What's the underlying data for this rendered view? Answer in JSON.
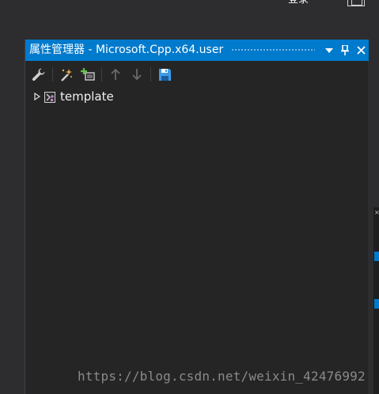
{
  "top": {
    "login_label": "登录"
  },
  "panel": {
    "title": "属性管理器 - Microsoft.Cpp.x64.user",
    "title_buttons": [
      "dropdown-icon",
      "pin-icon",
      "close-icon"
    ],
    "toolbar": [
      "wrench-icon",
      "add-new-sheet-icon",
      "add-existing-sheet-icon",
      "move-up-icon",
      "move-down-icon",
      "save-icon"
    ]
  },
  "tree": {
    "items": [
      {
        "label": "template",
        "expanded": false,
        "icon": "project-icon"
      }
    ]
  },
  "watermark": "https://blog.csdn.net/weixin_42476992",
  "colors": {
    "accent": "#007acc",
    "panel_bg": "#252526",
    "window_bg": "#2d2d30"
  }
}
